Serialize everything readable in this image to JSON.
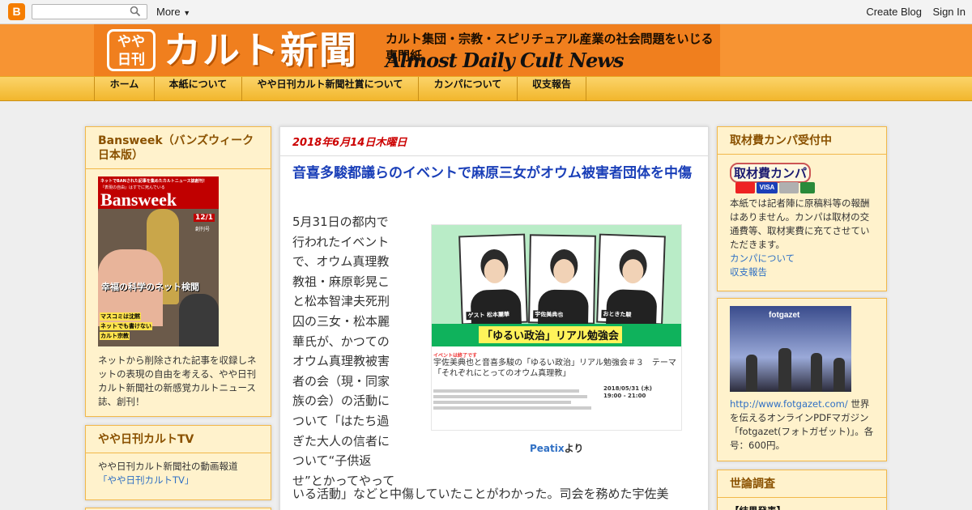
{
  "navbar": {
    "logo": "B",
    "more": "More",
    "create_blog": "Create Blog",
    "sign_in": "Sign In"
  },
  "header": {
    "badge_top": "やや",
    "badge_bottom": "日刊",
    "title": "カルト新聞",
    "subtitle": "カルト集団・宗教・スピリチュアル産業の社会問題をいじる専門紙",
    "title_en": "Almost Daily Cult News"
  },
  "tabs": [
    "ホーム",
    "本紙について",
    "やや日刊カルト新聞社賞について",
    "カンパについて",
    "収支報告"
  ],
  "left": {
    "bansweek": {
      "title": "Bansweek（バンズウィーク日本版）",
      "cover_top": "ネットでBANされた記事を集めたカルトニュース誌創刊！",
      "cover_sub": "『表現の自由』はすでに死んでいる",
      "cover_brand": "Bansweek",
      "cover_issue": "12/1",
      "cover_issue_sub": "創刊号",
      "cover_headline": "幸福の科学のネット検閲",
      "cover_tag1": "マスコミは沈黙",
      "cover_tag2": "ネットでも書けない",
      "cover_tag3": "カルト宗教",
      "description": "ネットから削除された記事を収録しネットの表現の自由を考える、やや日刊カルト新聞社の新感覚カルトニュース誌、創刊！"
    },
    "tv": {
      "title": "やや日刊カルトTV",
      "description": "やや日刊カルト新聞社の動画報道",
      "link": "「やや日刊カルトTV」"
    }
  },
  "main": {
    "date": "2018年6月14日木曜日",
    "title": "音喜多駿都議らのイベントで麻原三女がオウム被害者団体を中傷",
    "body_lines": [
      "5月31日の都内で",
      "行われたイベント",
      "で、オウム真理教",
      "教祖・麻原彰晃こ",
      "と松本智津夫死刑",
      "囚の三女・松本麗",
      "華氏が、かつての",
      "オウム真理教被害",
      "者の会（現・同家",
      "族の会）の活動に",
      "ついて「はたち過",
      "ぎた大人の信者に",
      "ついて“子供返",
      "せ”とかってやって"
    ],
    "body_bottom": "いる活動」などと中傷していたことがわかった。司会を務めた宇佐美",
    "image": {
      "person1": "ゲスト 松本麗華",
      "person2": "宇佐美典也",
      "person3": "おときた駿",
      "band": "「ゆるい政治」リアル勉強会",
      "tag": "イベントは終了です",
      "caption": "宇佐美典也と音喜多駿の「ゆるい政治」リアル勉強会＃３　テーマ「それぞれにとってのオウム真理教」",
      "date": "2018/05/31 (木)",
      "time": "19:00 - 21:00"
    },
    "credit_link": "Peatix",
    "credit_suffix": "より"
  },
  "right": {
    "donate": {
      "title": "取材費カンパ受付中",
      "button": "取材費カンパ",
      "cards": "VISA",
      "description": "本紙では記者陣に原稿料等の報酬はありません。カンパは取材の交通費等、取材実費に充てさせていただきます。",
      "link1": "カンパについて",
      "link2": "収支報告"
    },
    "fotgazet": {
      "brand": "fotgazet",
      "url": "http://www.fotgazet.com/",
      "description": "世界を伝えるオンラインPDFマガジン「fotgazet(フォトガゼット)」。各号：600円。"
    },
    "poll": {
      "title": "世論調査",
      "result": "【結果発表】"
    }
  },
  "colors": {
    "header_orange": "#f79433",
    "tab_gold": "#f2b62c",
    "widget_bg": "#fff2cc",
    "date_red": "#cc0000",
    "title_blue": "#1a3fb8"
  }
}
